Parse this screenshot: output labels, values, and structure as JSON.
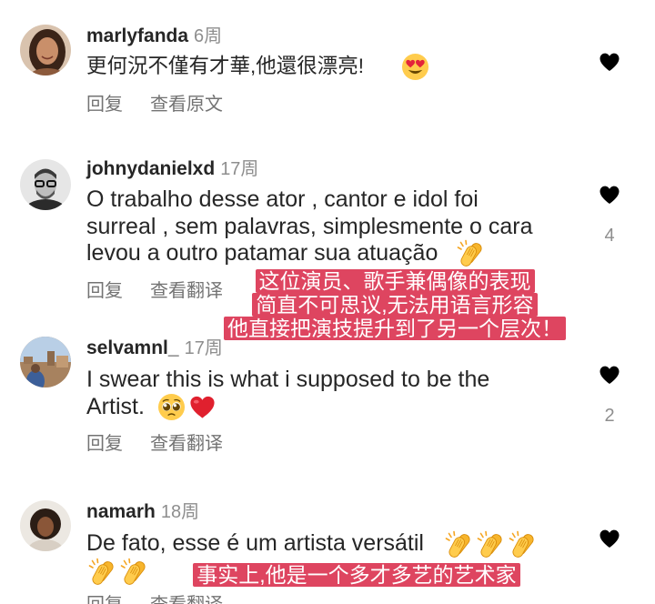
{
  "comments": [
    {
      "username": "marlyfanda",
      "time": "6周",
      "text_lines": [
        "更何況不僅有才華,他還很漂亮!"
      ],
      "emoji": [
        "smiling-face-with-heart-eyes"
      ],
      "reply_label": "回复",
      "translate_label": "查看原文",
      "like_icon": "heart-outline-icon",
      "liked": false
    },
    {
      "username": "johnydanielxd",
      "time": "17周",
      "text_lines": [
        "O trabalho desse ator , cantor e idol foi",
        "surreal , sem palavras, simplesmente o cara",
        "levou a outro patamar sua atuação"
      ],
      "emoji": [
        "clapping-hands"
      ],
      "reply_label": "回复",
      "translate_label": "查看翻译",
      "like_icon": "heart-filled-icon",
      "liked": true,
      "like_count": "4"
    },
    {
      "username": "selvamnl_",
      "time": "17周",
      "text_lines": [
        "I swear this is what i supposed to be the",
        "Artist."
      ],
      "emoji": [
        "pleading-face",
        "red-heart"
      ],
      "reply_label": "回复",
      "translate_label": "查看翻译",
      "like_icon": "heart-outline-icon",
      "liked": false,
      "like_count": "2"
    },
    {
      "username": "namarh",
      "time": "18周",
      "text_lines": [
        "De fato, esse é um artista versátil"
      ],
      "emoji": [
        "clapping-hands",
        "clapping-hands",
        "clapping-hands",
        "clapping-hands",
        "clapping-hands"
      ],
      "reply_label": "回复",
      "translate_label": "查看翻译",
      "like_icon": "heart-outline-icon",
      "liked": false
    }
  ],
  "translation_overlays": [
    {
      "lines": [
        "这位演员、歌手兼偶像的表现",
        "简直不可思议,无法用语言形容",
        "他直接把演技提升到了另一个层次！"
      ]
    },
    {
      "lines": [
        "事实上,他是一个多才多艺的艺术家"
      ]
    }
  ],
  "colors": {
    "text": "#262626",
    "secondary": "#8e8e8e",
    "action": "#737373",
    "like-red": "#ff3040",
    "overlay-bg": "#de4560",
    "overlay-text": "#ffffff"
  }
}
